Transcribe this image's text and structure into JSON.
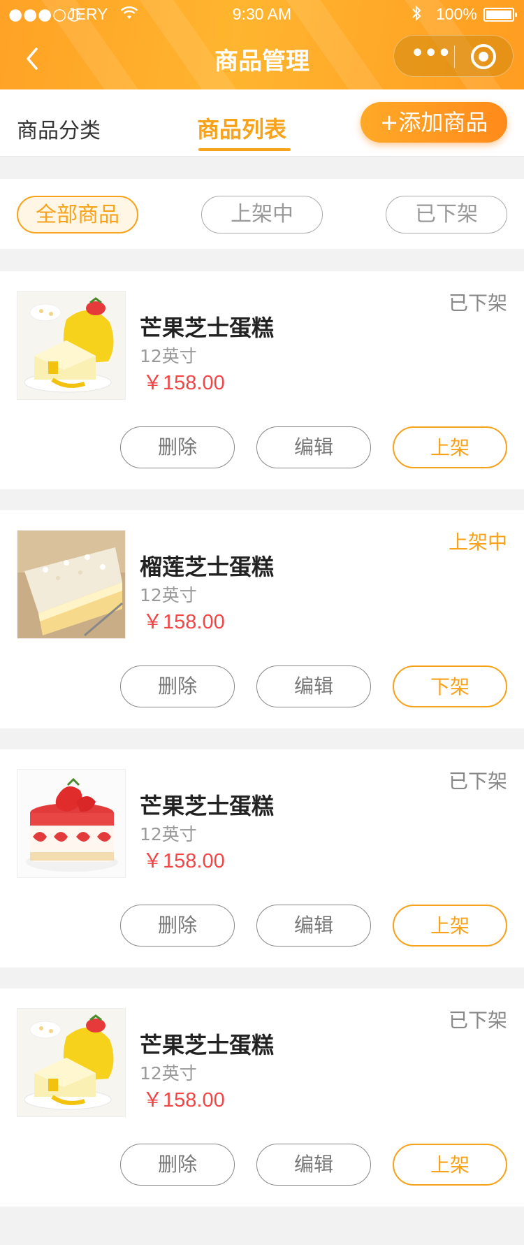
{
  "status_bar": {
    "signal": "●●●○○",
    "carrier": "JERY",
    "time": "9:30 AM",
    "battery": "100%"
  },
  "nav": {
    "title": "商品管理",
    "more": "•••"
  },
  "tabs": {
    "category": "商品分类",
    "list": "商品列表",
    "add_button": "+添加商品"
  },
  "filters": {
    "all": "全部商品",
    "on_sale": "上架中",
    "off_sale": "已下架"
  },
  "products": [
    {
      "name": "芒果芝士蛋糕",
      "spec": "12英寸",
      "price": "￥158.00",
      "status": "已下架",
      "delete_label": "删除",
      "edit_label": "编辑",
      "toggle_label": "上架",
      "image": "mango-cheesecake"
    },
    {
      "name": "榴莲芝士蛋糕",
      "spec": "12英寸",
      "price": "￥158.00",
      "status": "上架中",
      "delete_label": "删除",
      "edit_label": "编辑",
      "toggle_label": "下架",
      "image": "durian-cheesecake"
    },
    {
      "name": "芒果芝士蛋糕",
      "spec": "12英寸",
      "price": "￥158.00",
      "status": "已下架",
      "delete_label": "删除",
      "edit_label": "编辑",
      "toggle_label": "上架",
      "image": "strawberry-cake"
    },
    {
      "name": "芒果芝士蛋糕",
      "spec": "12英寸",
      "price": "￥158.00",
      "status": "已下架",
      "delete_label": "删除",
      "edit_label": "编辑",
      "toggle_label": "上架",
      "image": "mango-cheesecake"
    }
  ],
  "colors": {
    "accent": "#f7a21b",
    "price": "#f24545",
    "header_gradient_start": "#ffa225",
    "header_gradient_end": "#ff9d21"
  }
}
